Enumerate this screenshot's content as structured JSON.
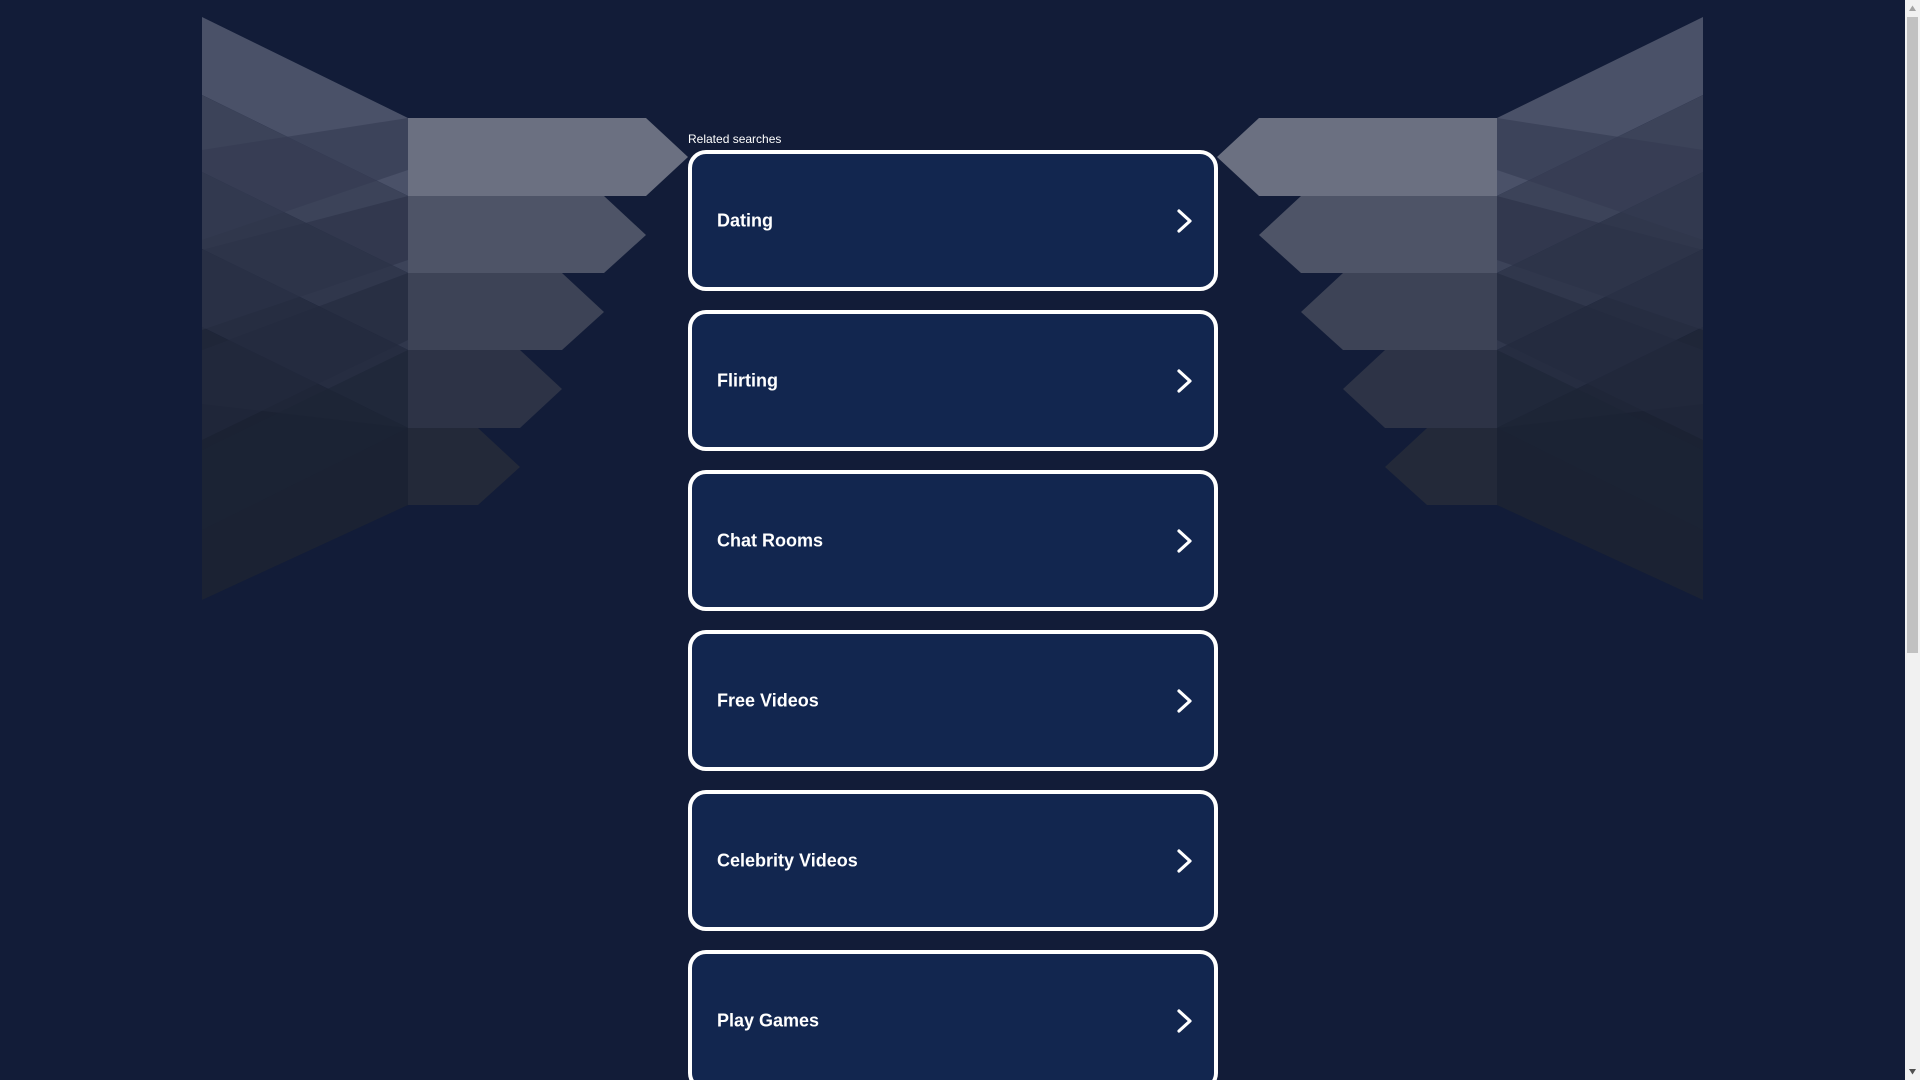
{
  "related": {
    "label": "Related searches",
    "items": [
      {
        "label": "Dating"
      },
      {
        "label": "Flirting"
      },
      {
        "label": "Chat Rooms"
      },
      {
        "label": "Free Videos"
      },
      {
        "label": "Celebrity Videos"
      },
      {
        "label": "Play Games"
      }
    ]
  },
  "icons": {
    "result_arrow": "chevron-right-icon",
    "scroll_up": "scroll-up-arrow-icon",
    "scroll_down": "scroll-down-arrow-icon"
  },
  "colors": {
    "background": "#121c38",
    "card": "#12264f",
    "card_border": "#ffffff",
    "text": "#ffffff"
  }
}
